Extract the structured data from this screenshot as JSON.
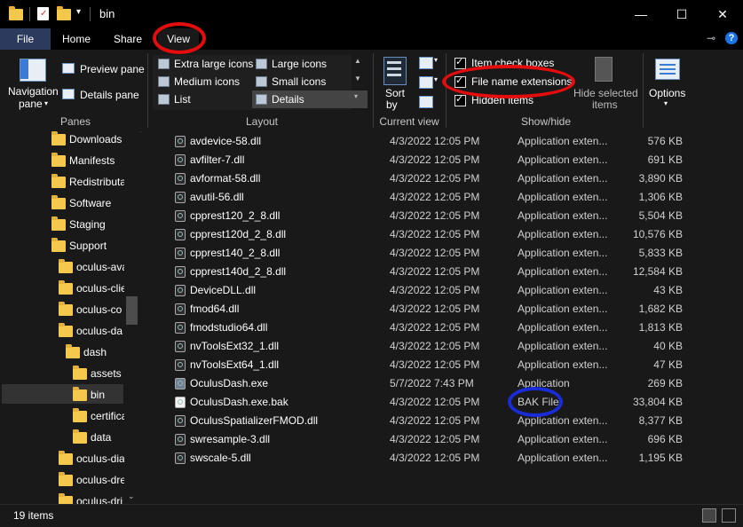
{
  "window": {
    "title": "bin",
    "minimize": "—",
    "maximize": "☐",
    "close": "✕"
  },
  "tabs": {
    "file": "File",
    "home": "Home",
    "share": "Share",
    "view": "View"
  },
  "ribbon": {
    "panes": {
      "navigation_line1": "Navigation",
      "navigation_line2": "pane",
      "preview": "Preview pane",
      "details": "Details pane",
      "group": "Panes"
    },
    "layout": {
      "extra_large": "Extra large icons",
      "large": "Large icons",
      "medium": "Medium icons",
      "small": "Small icons",
      "list": "List",
      "details": "Details",
      "group": "Layout"
    },
    "current_view": {
      "sort_line1": "Sort",
      "sort_line2": "by",
      "group": "Current view"
    },
    "show_hide": {
      "item_check_boxes": "Item check boxes",
      "file_name_extensions": "File name extensions",
      "hidden_items": "Hidden items",
      "hide_selected_line1": "Hide selected",
      "hide_selected_line2": "items",
      "group": "Show/hide"
    },
    "options": {
      "label": "Options"
    }
  },
  "nav_items": [
    {
      "label": "Downloads"
    },
    {
      "label": "Manifests"
    },
    {
      "label": "Redistributa"
    },
    {
      "label": "Software"
    },
    {
      "label": "Staging"
    },
    {
      "label": "Support"
    },
    {
      "label": "oculus-ava"
    },
    {
      "label": "oculus-clie"
    },
    {
      "label": "oculus-co"
    },
    {
      "label": "oculus-da"
    },
    {
      "label": "dash"
    },
    {
      "label": "assets"
    },
    {
      "label": "bin"
    },
    {
      "label": "certifica"
    },
    {
      "label": "data"
    },
    {
      "label": "oculus-dia"
    },
    {
      "label": "oculus-dre"
    },
    {
      "label": "oculus-dri"
    }
  ],
  "files": [
    {
      "name": "avdevice-58.dll",
      "date": "4/3/2022 12:05 PM",
      "type": "Application exten...",
      "size": "576 KB"
    },
    {
      "name": "avfilter-7.dll",
      "date": "4/3/2022 12:05 PM",
      "type": "Application exten...",
      "size": "691 KB"
    },
    {
      "name": "avformat-58.dll",
      "date": "4/3/2022 12:05 PM",
      "type": "Application exten...",
      "size": "3,890 KB"
    },
    {
      "name": "avutil-56.dll",
      "date": "4/3/2022 12:05 PM",
      "type": "Application exten...",
      "size": "1,306 KB"
    },
    {
      "name": "cpprest120_2_8.dll",
      "date": "4/3/2022 12:05 PM",
      "type": "Application exten...",
      "size": "5,504 KB"
    },
    {
      "name": "cpprest120d_2_8.dll",
      "date": "4/3/2022 12:05 PM",
      "type": "Application exten...",
      "size": "10,576 KB"
    },
    {
      "name": "cpprest140_2_8.dll",
      "date": "4/3/2022 12:05 PM",
      "type": "Application exten...",
      "size": "5,833 KB"
    },
    {
      "name": "cpprest140d_2_8.dll",
      "date": "4/3/2022 12:05 PM",
      "type": "Application exten...",
      "size": "12,584 KB"
    },
    {
      "name": "DeviceDLL.dll",
      "date": "4/3/2022 12:05 PM",
      "type": "Application exten...",
      "size": "43 KB"
    },
    {
      "name": "fmod64.dll",
      "date": "4/3/2022 12:05 PM",
      "type": "Application exten...",
      "size": "1,682 KB"
    },
    {
      "name": "fmodstudio64.dll",
      "date": "4/3/2022 12:05 PM",
      "type": "Application exten...",
      "size": "1,813 KB"
    },
    {
      "name": "nvToolsExt32_1.dll",
      "date": "4/3/2022 12:05 PM",
      "type": "Application exten...",
      "size": "40 KB"
    },
    {
      "name": "nvToolsExt64_1.dll",
      "date": "4/3/2022 12:05 PM",
      "type": "Application exten...",
      "size": "47 KB"
    },
    {
      "name": "OculusDash.exe",
      "date": "5/7/2022 7:43 PM",
      "type": "Application",
      "size": "269 KB"
    },
    {
      "name": "OculusDash.exe.bak",
      "date": "4/3/2022 12:05 PM",
      "type": "BAK File",
      "size": "33,804 KB"
    },
    {
      "name": "OculusSpatializerFMOD.dll",
      "date": "4/3/2022 12:05 PM",
      "type": "Application exten...",
      "size": "8,377 KB"
    },
    {
      "name": "swresample-3.dll",
      "date": "4/3/2022 12:05 PM",
      "type": "Application exten...",
      "size": "696 KB"
    },
    {
      "name": "swscale-5.dll",
      "date": "4/3/2022 12:05 PM",
      "type": "Application exten...",
      "size": "1,195 KB"
    }
  ],
  "status": {
    "item_count": "19 items"
  }
}
